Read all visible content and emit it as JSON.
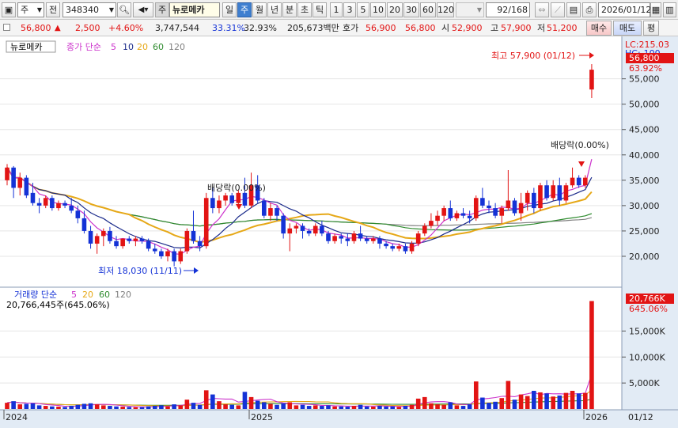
{
  "toolbar": {
    "market_type": "주",
    "prefix_btn": "전",
    "code": "348340",
    "name_icon_label": "주",
    "stock_name": "뉴로메카",
    "periods": [
      "일",
      "주",
      "월",
      "년",
      "분",
      "초",
      "틱"
    ],
    "selected_period": "주",
    "intervals": [
      "1",
      "3",
      "5",
      "10",
      "20",
      "30",
      "60",
      "120"
    ],
    "counter": "92",
    "counter_total": "/168",
    "date": "2026/01/12"
  },
  "quote": {
    "price": "56,800",
    "change_arrow": "▲",
    "change": "2,500",
    "change_pct": "+4.60%",
    "volume": "3,747,544",
    "ratio1": "33.31%",
    "ratio2": "32.93%",
    "amount": "205,673백만",
    "ask_label": "호가",
    "ask1": "56,900",
    "ask2": "56,800",
    "open_label": "시",
    "open": "52,900",
    "high_label": "고",
    "high": "57,900",
    "low_label": "저",
    "low": "51,200",
    "buy_button": "매수",
    "sell_button": "매도",
    "eval_button": "평"
  },
  "legend": {
    "name_box": "뉴로메카",
    "price_label": "종가 단순",
    "ma_periods": [
      "5",
      "10",
      "20",
      "60",
      "120"
    ],
    "volume_label": "거래량 단순",
    "volume_summary": "20,766,445주(645.06%)"
  },
  "colors": {
    "up": "#e21414",
    "down": "#1432d6",
    "ma5": "#cc33cc",
    "ma10": "#1a2a8a",
    "ma20": "#e6a817",
    "ma60": "#2e8b2e",
    "ma120": "#808080",
    "background_panel": "#e2ebf5"
  },
  "annotations": {
    "high_label": "최고 57,900 (01/12)",
    "low_label": "최저 18,030 (11/11)",
    "div1": "배당락(0.00%)",
    "div2": "배당락(0.00%)"
  },
  "price_axis": {
    "lc": "LC:215.03",
    "hc": "HC:-100",
    "current": "56,800",
    "current_pct": "63.92%",
    "ticks": [
      "55,000",
      "50,000",
      "45,000",
      "40,000",
      "35,000",
      "30,000",
      "25,000",
      "20,000"
    ]
  },
  "volume_axis": {
    "current": "20,766K",
    "current_pct": "645.06%",
    "ticks": [
      "15,000K",
      "10,000K",
      "5,000K"
    ]
  },
  "x_axis": {
    "labels": [
      "2024",
      "2025",
      "2026",
      "01/12"
    ]
  },
  "chart_data": {
    "type": "candlestick",
    "period": "weekly",
    "price_ylim": [
      17500,
      59000
    ],
    "volume_ylim": [
      0,
      21000
    ],
    "price_ticks": [
      20000,
      25000,
      30000,
      35000,
      40000,
      45000,
      50000,
      55000
    ],
    "volume_ticks": [
      5000,
      10000,
      15000
    ],
    "candles": [
      [
        35000,
        38200,
        34000,
        37500,
        1200
      ],
      [
        37500,
        37800,
        31500,
        33500,
        1500
      ],
      [
        33500,
        36500,
        32000,
        35500,
        900
      ],
      [
        35500,
        36000,
        31500,
        32000,
        1000
      ],
      [
        32500,
        34500,
        30000,
        30500,
        1100
      ],
      [
        30500,
        31500,
        28500,
        30000,
        700
      ],
      [
        30000,
        32000,
        29500,
        31500,
        600
      ],
      [
        31500,
        32000,
        29000,
        29500,
        500
      ],
      [
        29500,
        31000,
        29000,
        30500,
        450
      ],
      [
        30500,
        31000,
        29500,
        30000,
        400
      ],
      [
        30000,
        31500,
        28500,
        29000,
        600
      ],
      [
        29000,
        30000,
        26500,
        27500,
        800
      ],
      [
        27500,
        29000,
        24500,
        25000,
        1000
      ],
      [
        25000,
        26000,
        21500,
        22500,
        1100
      ],
      [
        22500,
        24500,
        20500,
        24000,
        900
      ],
      [
        24000,
        25500,
        22000,
        25000,
        700
      ],
      [
        25000,
        25800,
        22500,
        23000,
        600
      ],
      [
        23000,
        24000,
        21500,
        22000,
        500
      ],
      [
        22000,
        23500,
        21500,
        23500,
        450
      ],
      [
        23500,
        24000,
        22500,
        23000,
        400
      ],
      [
        23000,
        24000,
        22000,
        23500,
        350
      ],
      [
        23500,
        24000,
        22500,
        23000,
        350
      ],
      [
        23000,
        23500,
        21000,
        21500,
        500
      ],
      [
        21500,
        22500,
        20500,
        21000,
        600
      ],
      [
        21000,
        21500,
        19500,
        20000,
        700
      ],
      [
        20000,
        21500,
        19000,
        21000,
        500
      ],
      [
        21000,
        21500,
        18030,
        19000,
        900
      ],
      [
        19000,
        21500,
        18500,
        21000,
        700
      ],
      [
        21000,
        25500,
        20500,
        25000,
        1800
      ],
      [
        25000,
        29000,
        22500,
        23000,
        1200
      ],
      [
        23000,
        24000,
        21000,
        22000,
        800
      ],
      [
        22000,
        32500,
        21500,
        31500,
        3600
      ],
      [
        31500,
        33500,
        28500,
        29500,
        2800
      ],
      [
        29500,
        32000,
        28500,
        31000,
        1500
      ],
      [
        31000,
        32500,
        30000,
        32000,
        900
      ],
      [
        32000,
        32500,
        30000,
        30500,
        800
      ],
      [
        30500,
        33000,
        30000,
        32500,
        700
      ],
      [
        32500,
        35500,
        29500,
        30000,
        3300
      ],
      [
        30000,
        36500,
        29500,
        34000,
        2300
      ],
      [
        34000,
        36000,
        30500,
        31000,
        1600
      ],
      [
        31000,
        31500,
        27500,
        28000,
        1300
      ],
      [
        28000,
        30500,
        27000,
        29500,
        1000
      ],
      [
        29500,
        30000,
        27000,
        28000,
        800
      ],
      [
        28000,
        28500,
        23500,
        24500,
        1100
      ],
      [
        24500,
        26500,
        21000,
        25500,
        1300
      ],
      [
        25500,
        26500,
        24500,
        26000,
        700
      ],
      [
        26000,
        26500,
        23500,
        25000,
        800
      ],
      [
        25000,
        25500,
        24000,
        24500,
        600
      ],
      [
        24500,
        26500,
        24000,
        26000,
        700
      ],
      [
        26000,
        27000,
        24000,
        24500,
        600
      ],
      [
        24500,
        25000,
        22500,
        23000,
        700
      ],
      [
        23000,
        24500,
        22500,
        24000,
        500
      ],
      [
        24000,
        24500,
        22500,
        23500,
        500
      ],
      [
        23500,
        24500,
        22000,
        23000,
        450
      ],
      [
        23000,
        25000,
        22500,
        24500,
        600
      ],
      [
        24500,
        26000,
        23000,
        23500,
        800
      ],
      [
        23500,
        24000,
        22500,
        23000,
        500
      ],
      [
        23000,
        24000,
        22500,
        23500,
        450
      ],
      [
        23500,
        24000,
        21500,
        22500,
        600
      ],
      [
        22500,
        23000,
        21500,
        22000,
        500
      ],
      [
        22000,
        22500,
        21000,
        21500,
        500
      ],
      [
        21500,
        22500,
        21000,
        22000,
        400
      ],
      [
        22000,
        22500,
        20500,
        21000,
        600
      ],
      [
        21000,
        23000,
        20500,
        22500,
        800
      ],
      [
        22500,
        25000,
        22000,
        24500,
        2000
      ],
      [
        24500,
        26500,
        24000,
        26000,
        2300
      ],
      [
        26000,
        28500,
        25500,
        27000,
        1100
      ],
      [
        27000,
        29000,
        26000,
        28000,
        900
      ],
      [
        28000,
        30000,
        27000,
        29500,
        800
      ],
      [
        29500,
        31000,
        27000,
        27500,
        1300
      ],
      [
        27500,
        29000,
        27000,
        28500,
        700
      ],
      [
        28500,
        29500,
        27500,
        28000,
        600
      ],
      [
        28000,
        29000,
        26500,
        27500,
        900
      ],
      [
        27500,
        32000,
        27000,
        31500,
        5300
      ],
      [
        31500,
        33500,
        29500,
        30000,
        2200
      ],
      [
        30000,
        31000,
        28500,
        29500,
        1200
      ],
      [
        29500,
        30500,
        27500,
        28000,
        1400
      ],
      [
        28000,
        30000,
        26500,
        29500,
        2100
      ],
      [
        29500,
        37000,
        29000,
        31000,
        5400
      ],
      [
        31000,
        31500,
        28000,
        28500,
        1800
      ],
      [
        28500,
        32500,
        27000,
        30500,
        2800
      ],
      [
        30500,
        33000,
        29000,
        32500,
        2500
      ],
      [
        32500,
        33500,
        28500,
        29500,
        3500
      ],
      [
        29500,
        34500,
        29000,
        34000,
        3200
      ],
      [
        34000,
        35000,
        31000,
        31500,
        3000
      ],
      [
        31500,
        35000,
        31000,
        34000,
        2400
      ],
      [
        34000,
        35500,
        30000,
        31000,
        2600
      ],
      [
        31000,
        34500,
        30500,
        34000,
        3100
      ],
      [
        34000,
        37500,
        33500,
        35500,
        3500
      ],
      [
        35500,
        36000,
        33500,
        34000,
        3000
      ],
      [
        34000,
        36000,
        33500,
        35500,
        3100
      ],
      [
        52900,
        57900,
        51200,
        56800,
        20766
      ]
    ]
  }
}
